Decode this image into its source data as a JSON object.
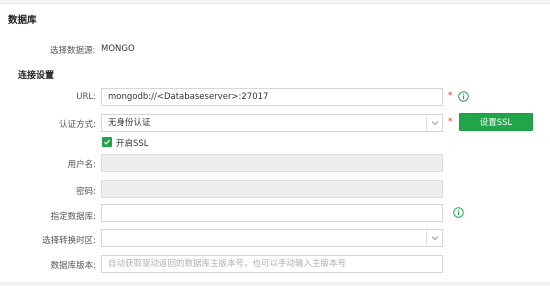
{
  "section_title": "数据库",
  "datasource": {
    "label": "选择数据源:",
    "value": "MONGO"
  },
  "connection": {
    "title": "连接设置",
    "url": {
      "label": "URL:",
      "value": "mongodb://<Databaseserver>:27017"
    },
    "auth": {
      "label": "认证方式:",
      "value": "无身份认证"
    },
    "ssl_button": "设置SSL",
    "ssl_checkbox": {
      "label": "开启SSL",
      "checked": true
    },
    "username": {
      "label": "用户名:"
    },
    "password": {
      "label": "密码:"
    },
    "database": {
      "label": "指定数据库:"
    },
    "timezone": {
      "label": "选择转换时区:"
    },
    "version": {
      "label": "数据库版本:",
      "placeholder": "自动获取驱动返回的数据库主版本号，也可以手动输入主版本号"
    },
    "required_mark": "*"
  },
  "colors": {
    "accent_green": "#22a44a",
    "required_red": "#e0352b"
  }
}
